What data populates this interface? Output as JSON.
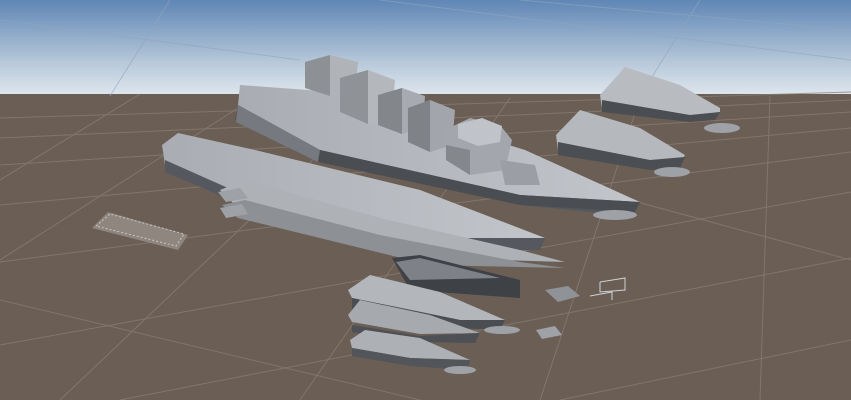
{
  "viewport": {
    "kind": "3d-scene-view",
    "colors": {
      "sky_top": "#5f86b5",
      "sky_horizon": "#dfe7ee",
      "ground": "#6b5e55",
      "grid_line": "#8e8178",
      "hull_light": "#b9bcc2",
      "hull_mid": "#9a9ea5",
      "hull_dark": "#55585e",
      "hull_shadow": "#3e4146"
    },
    "objects": [
      "destroyer-main-hull",
      "superstructure-blocks",
      "bridge-tower",
      "bow-piece-upper",
      "bow-piece-lower",
      "hull-section-long",
      "hull-section-mid",
      "hull-slices",
      "ground-decal-plate",
      "small-deck-parts"
    ]
  }
}
